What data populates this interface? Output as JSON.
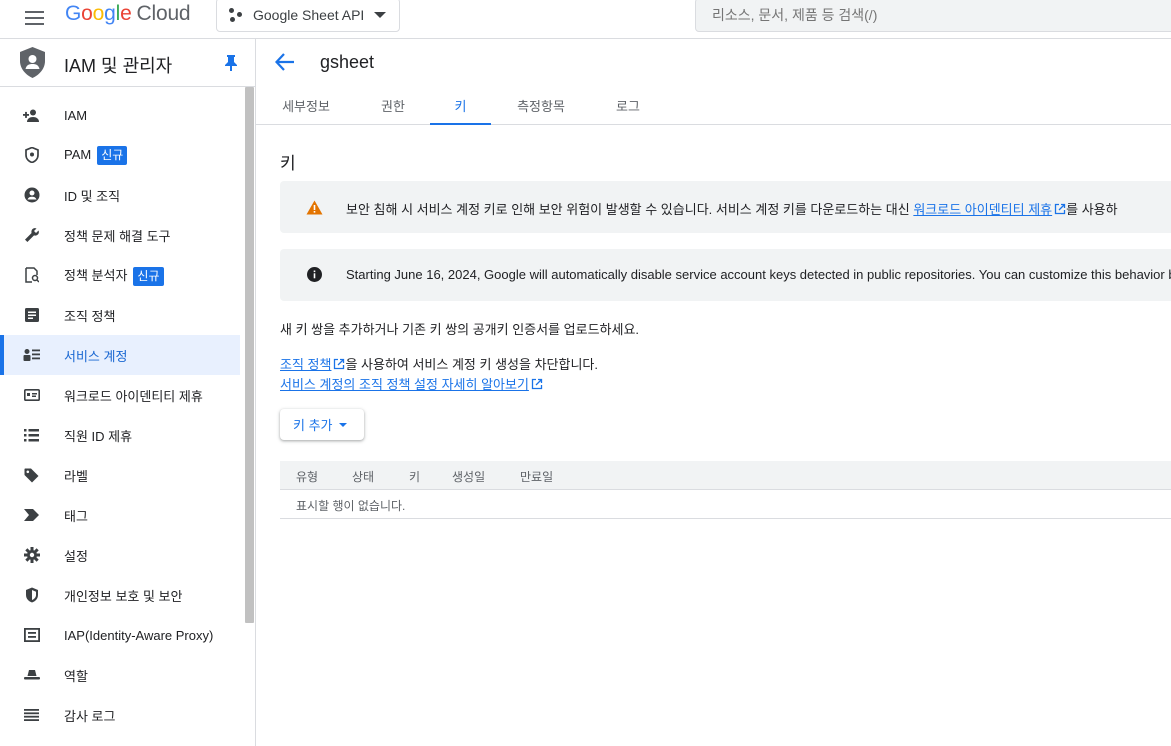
{
  "topbar": {
    "logo_google": "Google",
    "logo_cloud": "Cloud",
    "project_name": "Google Sheet API",
    "search_placeholder": "리소스, 문서, 제품 등 검색(/)"
  },
  "sidebar": {
    "title": "IAM 및 관리자",
    "items": [
      {
        "label": "IAM",
        "icon": "person-add-icon"
      },
      {
        "label": "PAM",
        "icon": "shield-icon",
        "badge": "신규"
      },
      {
        "label": "ID 및 조직",
        "icon": "account-circle-icon"
      },
      {
        "label": "정책 문제 해결 도구",
        "icon": "wrench-icon"
      },
      {
        "label": "정책 분석자",
        "icon": "policy-analyzer-icon",
        "badge": "신규"
      },
      {
        "label": "조직 정책",
        "icon": "document-icon"
      },
      {
        "label": "서비스 계정",
        "icon": "service-account-icon",
        "active": true
      },
      {
        "label": "워크로드 아이덴티티 제휴",
        "icon": "id-card-icon"
      },
      {
        "label": "직원 ID 제휴",
        "icon": "list-icon"
      },
      {
        "label": "라벨",
        "icon": "label-tag-icon"
      },
      {
        "label": "태그",
        "icon": "tag-chevron-icon"
      },
      {
        "label": "설정",
        "icon": "gear-icon"
      },
      {
        "label": "개인정보 보호 및 보안",
        "icon": "privacy-shield-icon"
      },
      {
        "label": "IAP(Identity-Aware Proxy)",
        "icon": "iap-icon"
      },
      {
        "label": "역할",
        "icon": "hat-icon"
      },
      {
        "label": "감사 로그",
        "icon": "lines-icon"
      }
    ]
  },
  "main": {
    "title": "gsheet",
    "tabs": [
      "세부정보",
      "권한",
      "키",
      "측정항목",
      "로그"
    ],
    "active_tab": "키",
    "section_title": "키",
    "warning_banner": {
      "text_before": "보안 침해 시 서비스 계정 키로 인해 보안 위험이 발생할 수 있습니다. 서비스 계정 키를 다운로드하는 대신 ",
      "link": "워크로드 아이덴티티 제휴",
      "text_after": "를 사용하"
    },
    "info_banner": {
      "text": "Starting June 16, 2024, Google will automatically disable service account keys detected in public repositories. You can customize this behavior b"
    },
    "intro_text": "새 키 쌍을 추가하거나 기존 키 쌍의 공개키 인증서를 업로드하세요.",
    "policy_line": {
      "link": "조직 정책",
      "text": "을 사용하여 서비스 계정 키 생성을 차단합니다."
    },
    "learn_more_link": "서비스 계정의 조직 정책 설정 자세히 알아보기",
    "add_key_button": "키 추가",
    "table": {
      "headers": [
        "유형",
        "상태",
        "키",
        "생성일",
        "만료일"
      ],
      "empty_message": "표시할 행이 없습니다."
    }
  },
  "colors": {
    "accent": "#1a73e8",
    "warning": "#e37400",
    "banner_bg": "#f1f3f4",
    "active_bg": "#e8f0fe"
  }
}
